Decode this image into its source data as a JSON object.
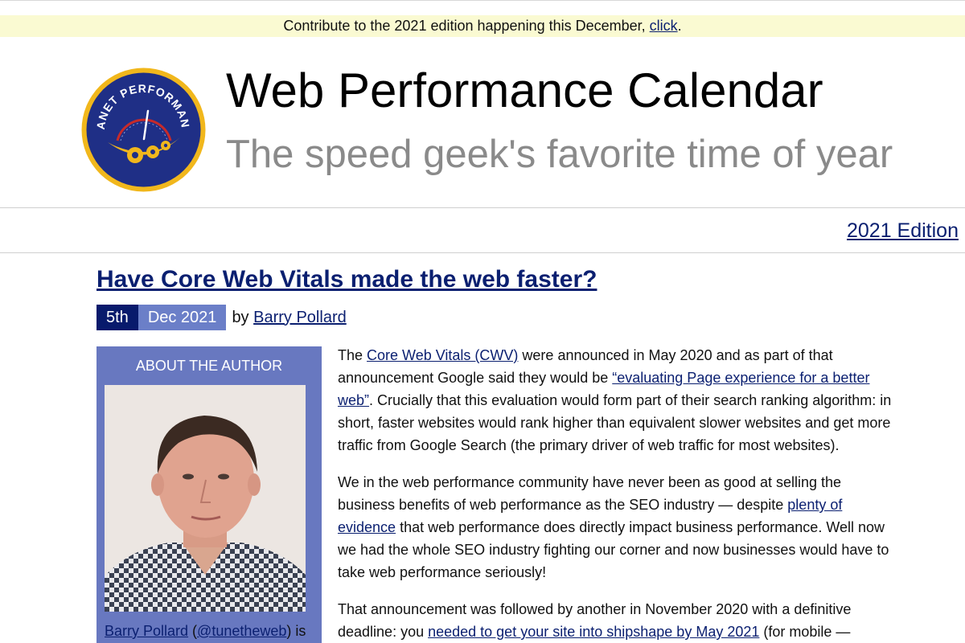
{
  "banner": {
    "text_before": "Contribute to the 2021 edition happening this December, ",
    "link": "click",
    "text_after": "."
  },
  "logo": {
    "text": "PLANET PERFORMANCE"
  },
  "site": {
    "title": "Web Performance Calendar",
    "tagline": "The speed geek's favorite time of year"
  },
  "nav": {
    "edition_link": "2021 Edition"
  },
  "post": {
    "title": "Have Core Web Vitals made the web faster?",
    "date_day": "5th",
    "date_rest": "Dec 2021",
    "by": "by",
    "author": "Barry Pollard"
  },
  "author_box": {
    "heading": "ABOUT THE AUTHOR",
    "name_link": "Barry Pollard",
    "paren_open": " (",
    "handle_link": "@tunetheweb",
    "paren_close": ") is"
  },
  "article": {
    "p1": {
      "t1": "The ",
      "l1": "Core Web Vitals (CWV)",
      "t2": " were announced in May 2020 and as part of that announcement Google said they would be ",
      "l2": "“evaluating Page experience for a better web”",
      "t3": ". Crucially that this evaluation would form part of their search ranking algorithm: in short, faster websites would rank higher than equivalent slower websites and get more traffic from Google Search (the primary driver of web traffic for most websites)."
    },
    "p2": {
      "t1": "We in the web performance community have never been as good at selling the business benefits of web performance as the SEO industry — despite ",
      "l1": "plenty of evidence",
      "t2": " that web performance does directly impact business performance. Well now we had the whole SEO industry fighting our corner and now businesses would have to take web performance seriously!"
    },
    "p3": {
      "t1": "That announcement was followed by another in November 2020 with a definitive deadline: you ",
      "l1": "needed to get your site into shipshape by May 2021",
      "t2": " (for mobile —"
    }
  }
}
